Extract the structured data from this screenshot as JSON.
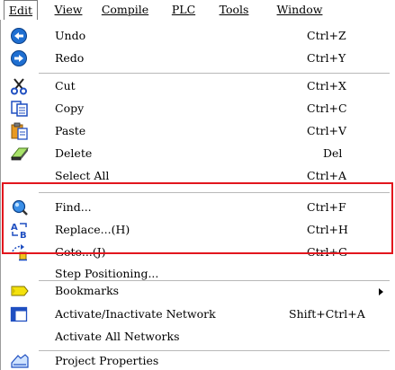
{
  "menubar": {
    "items": [
      {
        "label": "Edit",
        "active": true
      },
      {
        "label": "View"
      },
      {
        "label": "Compile"
      },
      {
        "label": "PLC"
      },
      {
        "label": "Tools"
      },
      {
        "label": "Window"
      }
    ]
  },
  "menu": {
    "items": [
      {
        "label": "Undo",
        "shortcut": "Ctrl+Z",
        "icon": "undo-icon"
      },
      {
        "label": "Redo",
        "shortcut": "Ctrl+Y",
        "icon": "redo-icon"
      },
      {
        "label": "Cut",
        "shortcut": "Ctrl+X",
        "icon": "cut-icon"
      },
      {
        "label": "Copy",
        "shortcut": "Ctrl+C",
        "icon": "copy-icon"
      },
      {
        "label": "Paste",
        "shortcut": "Ctrl+V",
        "icon": "paste-icon"
      },
      {
        "label": "Delete",
        "shortcut": "Del",
        "icon": "eraser-icon"
      },
      {
        "label": "Select All",
        "shortcut": "Ctrl+A"
      },
      {
        "label": "Find...",
        "shortcut": "Ctrl+F",
        "icon": "find-icon"
      },
      {
        "label": "Replace...(H)",
        "shortcut": "Ctrl+H",
        "icon": "replace-icon"
      },
      {
        "label": "Goto...(J)",
        "shortcut": "Ctrl+G",
        "icon": "goto-icon"
      },
      {
        "label": "Step Positioning..."
      },
      {
        "label": "Bookmarks",
        "submenu": true,
        "icon": "bookmark-icon"
      },
      {
        "label": "Activate/Inactivate Network",
        "shortcut": "Shift+Ctrl+A",
        "icon": "network-icon"
      },
      {
        "label": "Activate All Networks"
      },
      {
        "label": "Project Properties",
        "icon": "project-properties-icon"
      }
    ]
  },
  "colors": {
    "highlight_border": "#e2161d",
    "icon_blue": "#1f6fd1"
  }
}
